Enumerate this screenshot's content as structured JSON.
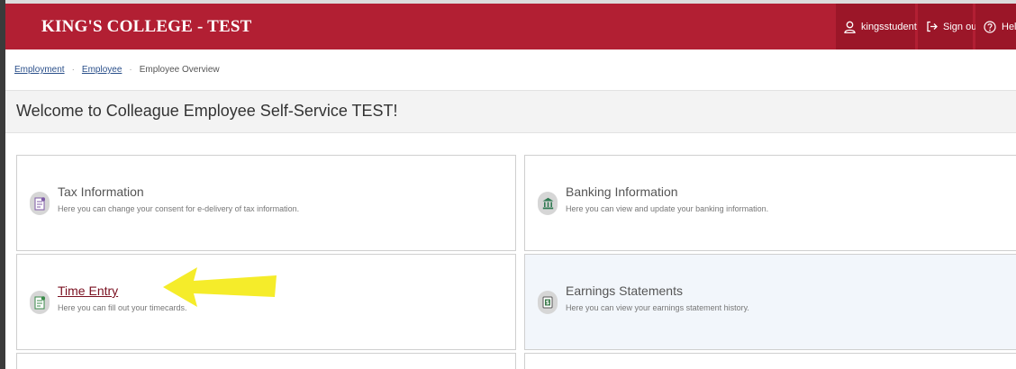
{
  "header": {
    "brand": "KING'S COLLEGE - TEST",
    "user_label": "kingsstudent",
    "signout_label": "Sign out",
    "help_label": "Hel",
    "bar_color": "#b21f33",
    "button_color": "#9b1628"
  },
  "breadcrumb": {
    "items": [
      "Employment",
      "Employee",
      "Employee Overview"
    ],
    "separator": "·"
  },
  "page": {
    "title": "Welcome to Colleague Employee Self-Service TEST!"
  },
  "tiles": [
    {
      "title": "Tax Information",
      "description": "Here you can change your consent for e-delivery of tax information.",
      "icon": "tax-document-icon"
    },
    {
      "title": "Banking Information",
      "description": "Here you can view and update your banking information.",
      "icon": "bank-icon"
    },
    {
      "title": "Time Entry",
      "description": "Here you can fill out your timecards.",
      "icon": "timecard-icon",
      "annotation": "yellow-arrow-pointing-left"
    },
    {
      "title": "Earnings Statements",
      "description": "Here you can view your earnings statement history.",
      "icon": "earnings-statement-icon"
    }
  ]
}
